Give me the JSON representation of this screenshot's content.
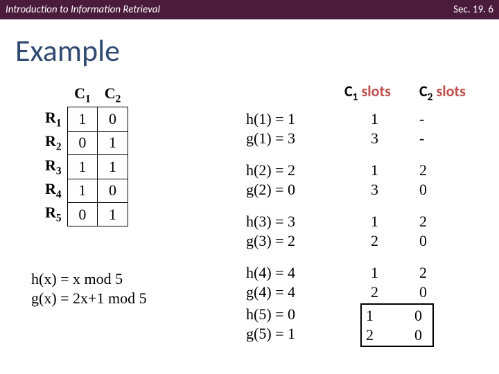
{
  "header": {
    "left": "Introduction to Information Retrieval",
    "right": "Sec. 19. 6"
  },
  "title": "Example",
  "matrix": {
    "col1": "C",
    "col1_sub": "1",
    "col2": "C",
    "col2_sub": "2",
    "rows": [
      {
        "r": "R",
        "sub": "1",
        "c1": "1",
        "c2": "0"
      },
      {
        "r": "R",
        "sub": "2",
        "c1": "0",
        "c2": "1"
      },
      {
        "r": "R",
        "sub": "3",
        "c1": "1",
        "c2": "1"
      },
      {
        "r": "R",
        "sub": "4",
        "c1": "1",
        "c2": "0"
      },
      {
        "r": "R",
        "sub": "5",
        "c1": "0",
        "c2": "1"
      }
    ]
  },
  "formulas": {
    "h": "h(x) = x mod 5",
    "g": "g(x) = 2x+1 mod 5"
  },
  "slots_header": {
    "c1_a": "C",
    "c1_sub": "1",
    "c1_word": "slots",
    "c2_a": "C",
    "c2_sub": "2",
    "c2_word": "slots"
  },
  "steps": [
    {
      "h": "h(1) = 1",
      "g": "g(1) = 3",
      "c1a": "1",
      "c1b": "3",
      "c2a": "-",
      "c2b": "-"
    },
    {
      "h": "h(2) = 2",
      "g": "g(2) = 0",
      "c1a": "1",
      "c1b": "3",
      "c2a": "2",
      "c2b": "0"
    },
    {
      "h": "h(3) = 3",
      "g": "g(3) = 2",
      "c1a": "1",
      "c1b": "2",
      "c2a": "2",
      "c2b": "0"
    },
    {
      "h": "h(4) = 4",
      "g": "g(4) = 4",
      "c1a": "1",
      "c1b": "2",
      "c2a": "2",
      "c2b": "0"
    },
    {
      "h": "h(5) = 0",
      "g": "g(5) = 1",
      "c1a": "1",
      "c1b": "2",
      "c2a": "0",
      "c2b": "0"
    }
  ]
}
